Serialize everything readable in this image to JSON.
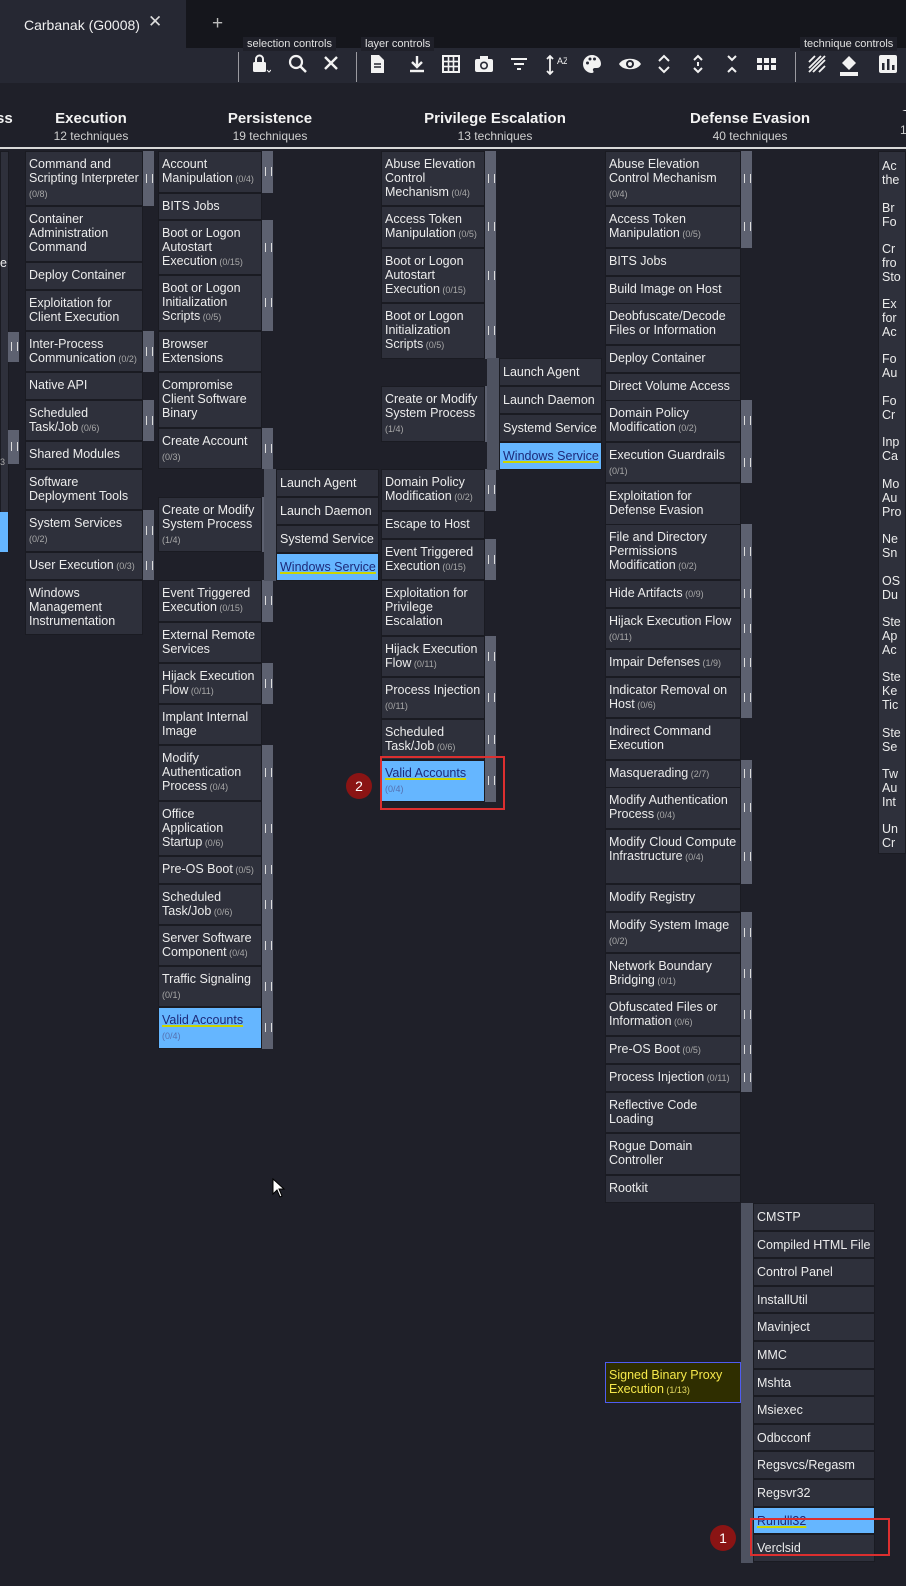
{
  "tab": {
    "title": "Carbanak (G0008)",
    "close": "✕",
    "new_tab": "+"
  },
  "toolbar": {
    "selection_label": "selection controls",
    "layer_label": "layer controls",
    "technique_label": "technique controls",
    "sort_glyph": "AZ"
  },
  "tactics": [
    {
      "name": "Execution",
      "count": "12 techniques"
    },
    {
      "name": "Persistence",
      "count": "19 techniques"
    },
    {
      "name": "Privilege Escalation",
      "count": "13 techniques"
    },
    {
      "name": "Defense Evasion",
      "count": "40 techniques"
    }
  ],
  "left_fragment": {
    "name_tail": "ss"
  },
  "right_fragment": {
    "name_head": "C",
    "count_head": "1"
  },
  "execution": [
    {
      "label": "Command and Scripting Interpreter",
      "count": "(0/8)"
    },
    {
      "label": "Container Administration Command",
      "count": ""
    },
    {
      "label": "Deploy Container",
      "count": ""
    },
    {
      "label": "Exploitation for Client Execution",
      "count": ""
    },
    {
      "label": "Inter-Process Communication",
      "count": "(0/2)"
    },
    {
      "label": "Native API",
      "count": ""
    },
    {
      "label": "Scheduled Task/Job",
      "count": "(0/6)"
    },
    {
      "label": "Shared Modules",
      "count": ""
    },
    {
      "label": "Software Deployment Tools",
      "count": ""
    },
    {
      "label": "System Services",
      "count": "(0/2)"
    },
    {
      "label": "User Execution",
      "count": "(0/3)"
    },
    {
      "label": "Windows Management Instrumentation",
      "count": ""
    }
  ],
  "persistence": [
    {
      "label": "Account Manipulation",
      "count": "(0/4)"
    },
    {
      "label": "BITS Jobs",
      "count": ""
    },
    {
      "label": "Boot or Logon Autostart Execution",
      "count": "(0/15)"
    },
    {
      "label": "Boot or Logon Initialization Scripts",
      "count": "(0/5)"
    },
    {
      "label": "Browser Extensions",
      "count": ""
    },
    {
      "label": "Compromise Client Software Binary",
      "count": ""
    },
    {
      "label": "Create Account",
      "count": "(0/3)"
    },
    {
      "label": "Create or Modify System Process",
      "count": "(1/4)"
    },
    {
      "label": "Event Triggered Execution",
      "count": "(0/15)"
    },
    {
      "label": "External Remote Services",
      "count": ""
    },
    {
      "label": "Hijack Execution Flow",
      "count": "(0/11)"
    },
    {
      "label": "Implant Internal Image",
      "count": ""
    },
    {
      "label": "Modify Authentication Process",
      "count": "(0/4)"
    },
    {
      "label": "Office Application Startup",
      "count": "(0/6)"
    },
    {
      "label": "Pre-OS Boot",
      "count": "(0/5)"
    },
    {
      "label": "Scheduled Task/Job",
      "count": "(0/6)"
    },
    {
      "label": "Server Software Component",
      "count": "(0/4)"
    },
    {
      "label": "Traffic Signaling",
      "count": "(0/1)"
    },
    {
      "label": "Valid Accounts",
      "count": "(0/4)"
    }
  ],
  "persistence_subs": [
    "Launch Agent",
    "Launch Daemon",
    "Systemd Service",
    "Windows Service"
  ],
  "privesc": [
    {
      "label": "Abuse Elevation Control Mechanism",
      "count": "(0/4)"
    },
    {
      "label": "Access Token Manipulation",
      "count": "(0/5)"
    },
    {
      "label": "Boot or Logon Autostart Execution",
      "count": "(0/15)"
    },
    {
      "label": "Boot or Logon Initialization Scripts",
      "count": "(0/5)"
    },
    {
      "label": "Create or Modify System Process",
      "count": "(1/4)"
    },
    {
      "label": "Domain Policy Modification",
      "count": "(0/2)"
    },
    {
      "label": "Escape to Host",
      "count": ""
    },
    {
      "label": "Event Triggered Execution",
      "count": "(0/15)"
    },
    {
      "label": "Exploitation for Privilege Escalation",
      "count": ""
    },
    {
      "label": "Hijack Execution Flow",
      "count": "(0/11)"
    },
    {
      "label": "Process Injection",
      "count": "(0/11)"
    },
    {
      "label": "Scheduled Task/Job",
      "count": "(0/6)"
    },
    {
      "label": "Valid Accounts",
      "count": "(0/4)"
    }
  ],
  "privesc_subs": [
    "Launch Agent",
    "Launch Daemon",
    "Systemd Service",
    "Windows Service"
  ],
  "defense": [
    {
      "label": "Abuse Elevation Control Mechanism",
      "count": "(0/4)"
    },
    {
      "label": "Access Token Manipulation",
      "count": "(0/5)"
    },
    {
      "label": "BITS Jobs",
      "count": ""
    },
    {
      "label": "Build Image on Host",
      "count": ""
    },
    {
      "label": "Deobfuscate/Decode Files or Information",
      "count": ""
    },
    {
      "label": "Deploy Container",
      "count": ""
    },
    {
      "label": "Direct Volume Access",
      "count": ""
    },
    {
      "label": "Domain Policy Modification",
      "count": "(0/2)"
    },
    {
      "label": "Execution Guardrails",
      "count": "(0/1)"
    },
    {
      "label": "Exploitation for Defense Evasion",
      "count": ""
    },
    {
      "label": "File and Directory Permissions Modification",
      "count": "(0/2)"
    },
    {
      "label": "Hide Artifacts",
      "count": "(0/9)"
    },
    {
      "label": "Hijack Execution Flow",
      "count": "(0/11)"
    },
    {
      "label": "Impair Defenses",
      "count": "(1/9)"
    },
    {
      "label": "Indicator Removal on Host",
      "count": "(0/6)"
    },
    {
      "label": "Indirect Command Execution",
      "count": ""
    },
    {
      "label": "Masquerading",
      "count": "(2/7)"
    },
    {
      "label": "Modify Authentication Process",
      "count": "(0/4)"
    },
    {
      "label": "Modify Cloud Compute Infrastructure",
      "count": "(0/4)"
    },
    {
      "label": "Modify Registry",
      "count": ""
    },
    {
      "label": "Modify System Image",
      "count": "(0/2)"
    },
    {
      "label": "Network Boundary Bridging",
      "count": "(0/1)"
    },
    {
      "label": "Obfuscated Files or Information",
      "count": "(0/6)"
    },
    {
      "label": "Pre-OS Boot",
      "count": "(0/5)"
    },
    {
      "label": "Process Injection",
      "count": "(0/11)"
    },
    {
      "label": "Reflective Code Loading",
      "count": ""
    },
    {
      "label": "Rogue Domain Controller",
      "count": ""
    },
    {
      "label": "Rootkit",
      "count": ""
    },
    {
      "label": "Signed Binary Proxy Execution",
      "count": "(1/13)"
    }
  ],
  "sbpe_subs": [
    "CMSTP",
    "Compiled HTML File",
    "Control Panel",
    "InstallUtil",
    "Mavinject",
    "MMC",
    "Mshta",
    "Msiexec",
    "Odbcconf",
    "Regsvcs/Regasm",
    "Regsvr32",
    "Rundll32",
    "Verclsid"
  ],
  "right_frag": [
    "Ac",
    "the",
    "Br",
    "Fo",
    "Cr",
    "fro",
    "Sto",
    "Ex",
    "for",
    "Ac",
    "Fo",
    "Au",
    "Fo",
    "Cr",
    "Inp",
    "Ca",
    "Mo",
    "Au",
    "Pro",
    "Ne",
    "Sn",
    "OS",
    "Du",
    "Ste",
    "Ap",
    "Ac",
    "Ste",
    "Ke",
    "Tic",
    "Ste",
    "Se",
    "Tw",
    "Au",
    "Int",
    "Un",
    "Cr"
  ],
  "left_frag": [
    "e",
    "3"
  ],
  "markers": {
    "one": "1",
    "two": "2"
  }
}
